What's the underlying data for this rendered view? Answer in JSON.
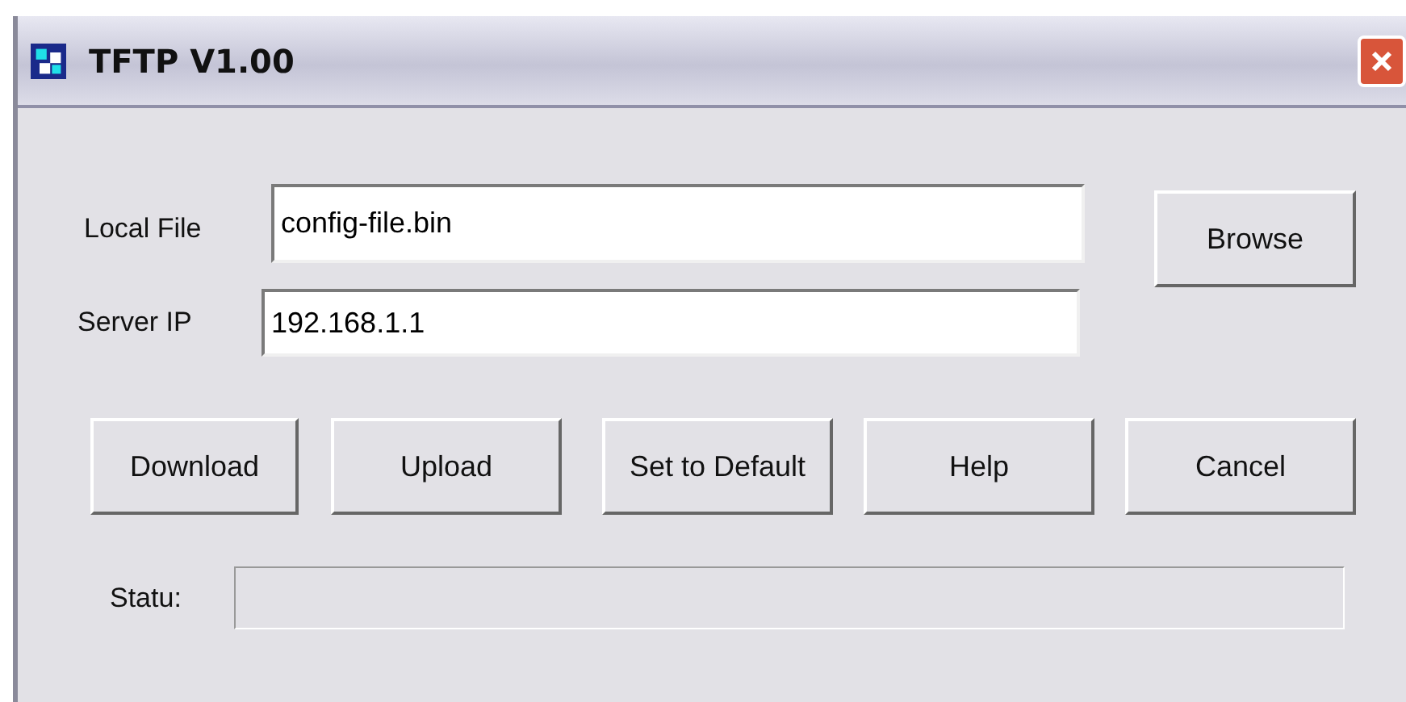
{
  "window": {
    "title": "TFTP V1.00"
  },
  "fields": [
    {
      "label": "Local File",
      "value": "config-file.bin"
    },
    {
      "label": "Server IP",
      "value": "192.168.1.1"
    }
  ],
  "browse_button": "Browse",
  "buttons": [
    "Download",
    "Upload",
    "Set to Default",
    "Help",
    "Cancel"
  ],
  "status": {
    "label": "Statu:"
  }
}
